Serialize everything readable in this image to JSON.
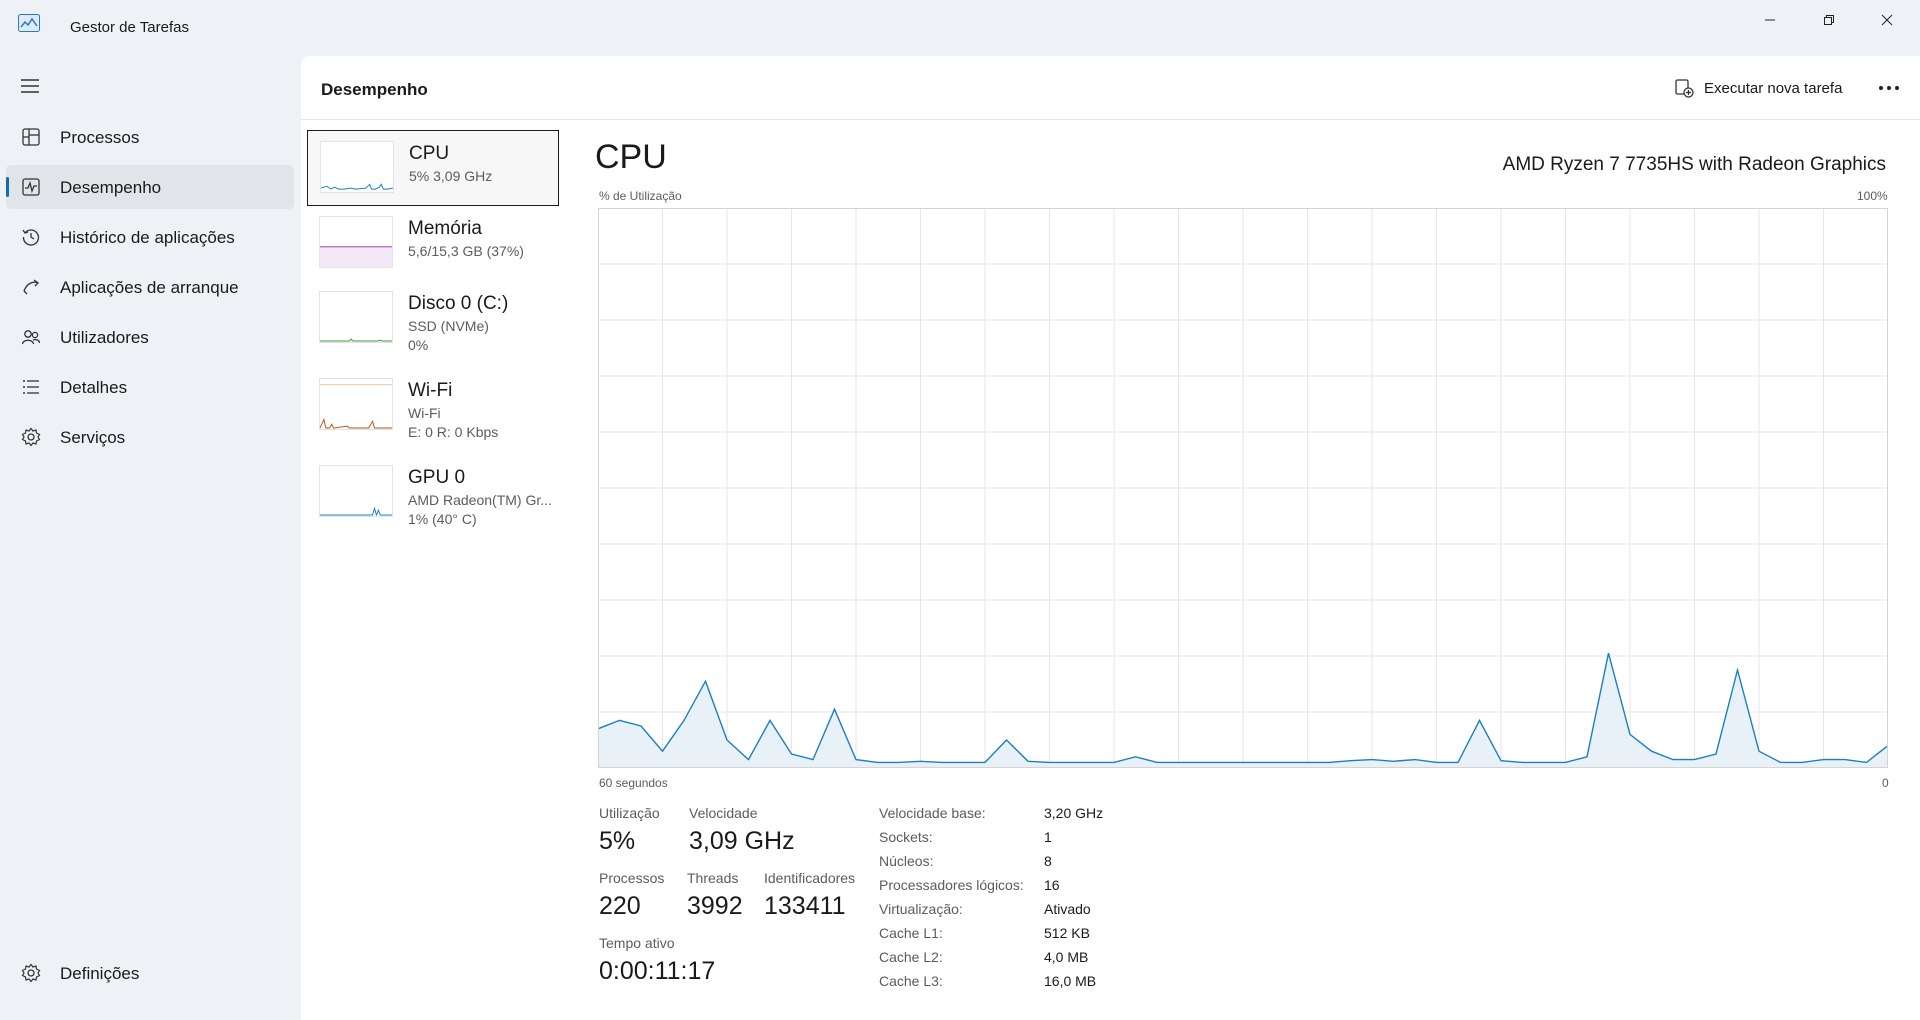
{
  "window": {
    "title": "Gestor de Tarefas"
  },
  "sidebar": {
    "items": [
      {
        "label": "Processos",
        "icon": "processes-icon"
      },
      {
        "label": "Desempenho",
        "icon": "performance-icon"
      },
      {
        "label": "Histórico de aplicações",
        "icon": "history-icon"
      },
      {
        "label": "Aplicações de arranque",
        "icon": "startup-icon"
      },
      {
        "label": "Utilizadores",
        "icon": "users-icon"
      },
      {
        "label": "Detalhes",
        "icon": "details-icon"
      },
      {
        "label": "Serviços",
        "icon": "services-icon"
      }
    ],
    "active_index": 1,
    "settings_label": "Definições"
  },
  "header": {
    "title": "Desempenho",
    "run_task_label": "Executar nova tarefa"
  },
  "devices": [
    {
      "name": "CPU",
      "line1": "5%  3,09 GHz",
      "line2": "",
      "color": "#1d7fc0"
    },
    {
      "name": "Memória",
      "line1": "5,6/15,3 GB (37%)",
      "line2": "",
      "color": "#8b2fa8"
    },
    {
      "name": "Disco 0 (C:)",
      "line1": "SSD (NVMe)",
      "line2": "0%",
      "color": "#3d9a3d"
    },
    {
      "name": "Wi-Fi",
      "line1": "Wi-Fi",
      "line2": "E: 0 R: 0 Kbps",
      "color": "#b5561c"
    },
    {
      "name": "GPU 0",
      "line1": "AMD Radeon(TM) Gr...",
      "line2": "1% (40° C)",
      "color": "#1d7fc0"
    }
  ],
  "cpu": {
    "title": "CPU",
    "model": "AMD Ryzen 7 7735HS with Radeon Graphics",
    "y_axis_label": "% de Utilização",
    "y_max_label": "100%",
    "x_left_label": "60 segundos",
    "x_right_label": "0",
    "stats": {
      "utilization_label": "Utilização",
      "utilization": "5%",
      "speed_label": "Velocidade",
      "speed": "3,09 GHz",
      "processes_label": "Processos",
      "processes": "220",
      "threads_label": "Threads",
      "threads": "3992",
      "handles_label": "Identificadores",
      "handles": "133411",
      "uptime_label": "Tempo ativo",
      "uptime": "0:00:11:17"
    },
    "specs": [
      {
        "label": "Velocidade base:",
        "value": "3,20 GHz"
      },
      {
        "label": "Sockets:",
        "value": "1"
      },
      {
        "label": "Núcleos:",
        "value": "8"
      },
      {
        "label": "Processadores lógicos:",
        "value": "16"
      },
      {
        "label": "Virtualização:",
        "value": "Ativado"
      },
      {
        "label": "Cache L1:",
        "value": "512 KB"
      },
      {
        "label": "Cache L2:",
        "value": "4,0 MB"
      },
      {
        "label": "Cache L3:",
        "value": "16,0 MB"
      }
    ]
  },
  "chart_data": {
    "type": "area",
    "ylim": [
      0,
      100
    ],
    "x_range_seconds": 60,
    "line_color": "#1d7fc0",
    "fill_color": "#e8f1f8",
    "grid_color": "#e6e6e6",
    "grid": true,
    "values": [
      7,
      8.5,
      7.5,
      3,
      8.5,
      15.5,
      5,
      1.5,
      8.5,
      2.5,
      1.5,
      10.5,
      1.5,
      1,
      1,
      1.2,
      1,
      1,
      1,
      5,
      1.2,
      1,
      1,
      1,
      1,
      2,
      1,
      1,
      1,
      1,
      1,
      1,
      1,
      1,
      1,
      1.3,
      1.5,
      1.2,
      1.5,
      1,
      1,
      8.5,
      1.3,
      1,
      1,
      1,
      2,
      20.5,
      6,
      3,
      1.5,
      1.5,
      2.5,
      17.5,
      3,
      1,
      1,
      1.5,
      1.5,
      1,
      4
    ]
  }
}
